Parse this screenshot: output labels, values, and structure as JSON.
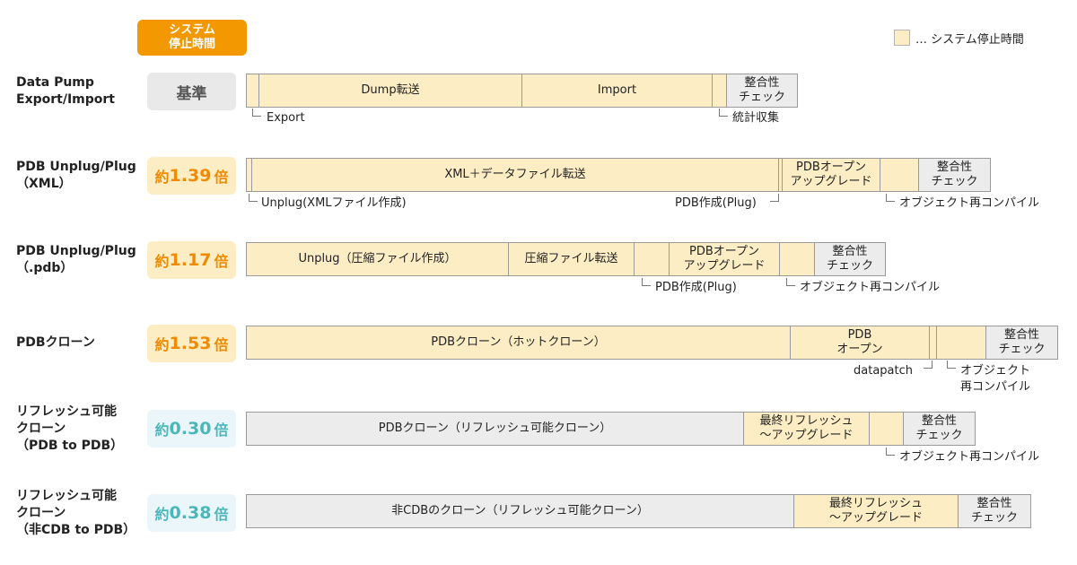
{
  "header": {
    "badge_line1": "システム",
    "badge_line2": "停止時間",
    "legend_text": "… システム停止時間",
    "legend_color": "#fdedc4"
  },
  "colors": {
    "accent_orange": "#f39800",
    "highlight_yellow": "#fdedc4",
    "neutral_gray": "#ececec",
    "blue_text": "#4cb7ba"
  },
  "rows": [
    {
      "label_lines": [
        "Data Pump",
        "Export/Import"
      ],
      "ratio_text": "基準",
      "segments": [
        "",
        "Dump転送",
        "Import",
        "",
        "整合性\nチェック"
      ],
      "notes": [
        "Export",
        "統計収集"
      ]
    },
    {
      "label_lines": [
        "PDB Unplug/Plug",
        "（XML）"
      ],
      "ratio_prefix": "約",
      "ratio_value": "1.39",
      "ratio_suffix": "倍",
      "segments": [
        "",
        "XML＋データファイル転送",
        "",
        "PDBオープン\nアップグレード",
        "",
        "整合性\nチェック"
      ],
      "notes": [
        "Unplug(XMLファイル作成)",
        "PDB作成(Plug)",
        "オブジェクト再コンパイル"
      ]
    },
    {
      "label_lines": [
        "PDB Unplug/Plug",
        "（.pdb）"
      ],
      "ratio_prefix": "約",
      "ratio_value": "1.17",
      "ratio_suffix": "倍",
      "segments": [
        "Unplug（圧縮ファイル作成）",
        "圧縮ファイル転送",
        "",
        "PDBオープン\nアップグレード",
        "",
        "整合性\nチェック"
      ],
      "notes": [
        "PDB作成(Plug)",
        "オブジェクト再コンパイル"
      ]
    },
    {
      "label_lines": [
        "PDBクローン"
      ],
      "ratio_prefix": "約",
      "ratio_value": "1.53",
      "ratio_suffix": "倍",
      "segments": [
        "PDBクローン（ホットクローン）",
        "PDB\nオープン",
        "",
        "",
        "整合性\nチェック"
      ],
      "notes": [
        "datapatch",
        "オブジェクト\n再コンパイル"
      ]
    },
    {
      "label_lines": [
        "リフレッシュ可能",
        "クローン",
        "（PDB to PDB）"
      ],
      "ratio_prefix": "約",
      "ratio_value": "0.30",
      "ratio_suffix": "倍",
      "segments": [
        "PDBクローン（リフレッシュ可能クローン）",
        "最終リフレッシュ\n～アップグレード",
        "",
        "整合性\nチェック"
      ],
      "notes": [
        "オブジェクト再コンパイル"
      ]
    },
    {
      "label_lines": [
        "リフレッシュ可能",
        "クローン",
        "（非CDB to PDB）"
      ],
      "ratio_prefix": "約",
      "ratio_value": "0.38",
      "ratio_suffix": "倍",
      "segments": [
        "非CDBのクローン（リフレッシュ可能クローン）",
        "最終リフレッシュ\n～アップグレード",
        "整合性\nチェック"
      ],
      "notes": []
    }
  ]
}
